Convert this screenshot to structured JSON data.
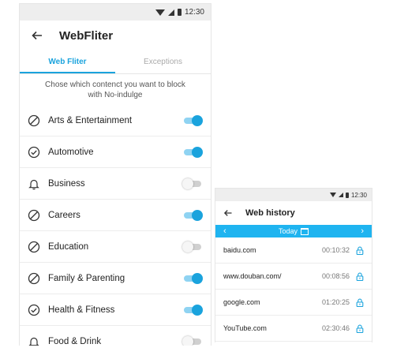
{
  "phone1": {
    "status_time": "12:30",
    "title": "WebFliter",
    "tabs": [
      {
        "label": "Web Fliter",
        "active": true
      },
      {
        "label": "Exceptions",
        "active": false
      }
    ],
    "description": "Chose which contenct you want to block with No-indulge",
    "categories": [
      {
        "label": "Arts & Entertainment",
        "icon": "block-icon",
        "enabled": true
      },
      {
        "label": "Automotive",
        "icon": "check-circle-icon",
        "enabled": true
      },
      {
        "label": "Business",
        "icon": "bell-icon",
        "enabled": false
      },
      {
        "label": "Careers",
        "icon": "block-icon",
        "enabled": true
      },
      {
        "label": "Education",
        "icon": "block-icon",
        "enabled": false
      },
      {
        "label": "Family & Parenting",
        "icon": "block-icon",
        "enabled": true
      },
      {
        "label": "Health & Fitness",
        "icon": "check-circle-icon",
        "enabled": true
      },
      {
        "label": "Food & Drink",
        "icon": "bell-icon",
        "enabled": false
      }
    ]
  },
  "phone2": {
    "status_time": "12:30",
    "title": "Web history",
    "date_label": "Today",
    "history": [
      {
        "site": "baidu.com",
        "time": "00:10:32"
      },
      {
        "site": "www.douban.com/",
        "time": "00:08:56"
      },
      {
        "site": "google.com",
        "time": "01:20:25"
      },
      {
        "site": "YouTube.com",
        "time": "02:30:46"
      }
    ]
  },
  "colors": {
    "accent": "#1aa3dd",
    "datebar": "#1fb4f0",
    "statusbar": "#eeeeee"
  }
}
